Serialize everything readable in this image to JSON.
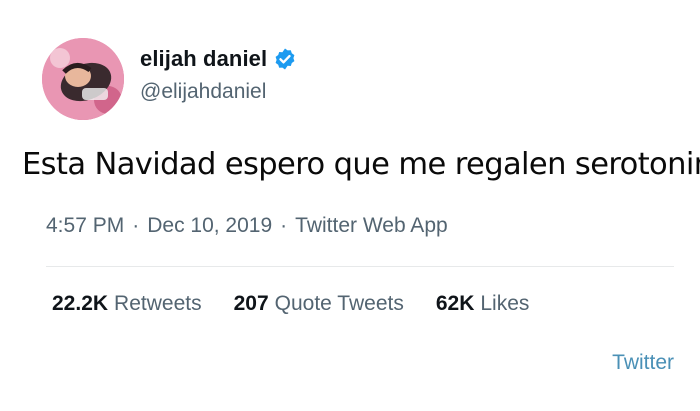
{
  "author": {
    "name": "elijah daniel",
    "handle": "@elijahdaniel",
    "verified": true,
    "avatar_icon": "profile-photo"
  },
  "tweet": {
    "text": "Esta Navidad espero que me regalen serotonina"
  },
  "meta": {
    "time": "4:57 PM",
    "separator": "·",
    "date": "Dec 10, 2019",
    "source": "Twitter Web App"
  },
  "stats": [
    {
      "count": "22.2K",
      "label": "Retweets"
    },
    {
      "count": "207",
      "label": "Quote Tweets"
    },
    {
      "count": "62K",
      "label": "Likes"
    }
  ],
  "footer": {
    "link": "Twitter"
  },
  "colors": {
    "verified_badge": "#1d9bf0",
    "secondary_text": "#536471",
    "link": "#4a90b6"
  }
}
